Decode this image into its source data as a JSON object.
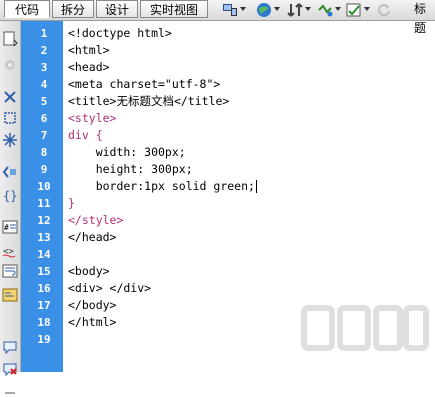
{
  "toolbar": {
    "view_buttons": [
      "代码",
      "拆分",
      "设计",
      "实时视图"
    ],
    "title_label": "标题",
    "icons": [
      "multiscreen-icon",
      "browser-preview-icon",
      "file-management-icon",
      "debug-icon",
      "visual-aids-icon",
      "refresh-icon"
    ]
  },
  "left_strip": {
    "icons": [
      "open-documents-icon",
      "collapse-icon",
      "collapse-tag-icon",
      "collapse-selection-icon",
      "expand-all-icon",
      "select-parent-icon",
      "balance-braces-icon",
      "line-numbers-icon",
      "highlight-invalid-icon",
      "word-wrap-icon",
      "syntax-coloring-icon",
      "apply-comment-icon",
      "remove-comment-icon",
      "wrap-tag-icon"
    ]
  },
  "editor": {
    "line_numbers": [
      "1",
      "2",
      "3",
      "4",
      "5",
      "6",
      "7",
      "8",
      "9",
      "10",
      "11",
      "12",
      "13",
      "14",
      "15",
      "16",
      "17",
      "18",
      "19"
    ],
    "lines": [
      {
        "text": "<!doctype html>",
        "kind": "tag"
      },
      {
        "text": "<html>",
        "kind": "tag"
      },
      {
        "text": "<head>",
        "kind": "tag"
      },
      {
        "text": "<meta charset=\"utf-8\">",
        "kind": "tag"
      },
      {
        "text": "<title>无标题文档</title>",
        "kind": "tag"
      },
      {
        "text": "<style>",
        "kind": "css"
      },
      {
        "text": "div {",
        "kind": "css"
      },
      {
        "text": "    width: 300px;",
        "kind": "prop"
      },
      {
        "text": "    height: 300px;",
        "kind": "prop"
      },
      {
        "text": "    border:1px solid green;",
        "kind": "prop"
      },
      {
        "text": "}",
        "kind": "css"
      },
      {
        "text": "</style>",
        "kind": "css"
      },
      {
        "text": "</head>",
        "kind": "tag"
      },
      {
        "text": "",
        "kind": "tag"
      },
      {
        "text": "<body>",
        "kind": "tag"
      },
      {
        "text": "<div> </div>",
        "kind": "tag"
      },
      {
        "text": "</body>",
        "kind": "tag"
      },
      {
        "text": "</html>",
        "kind": "tag"
      },
      {
        "text": "",
        "kind": "tag"
      }
    ]
  },
  "colors": {
    "gutter": "#3a8fe6",
    "css_text": "#b0307a",
    "default_text": "#000000"
  }
}
